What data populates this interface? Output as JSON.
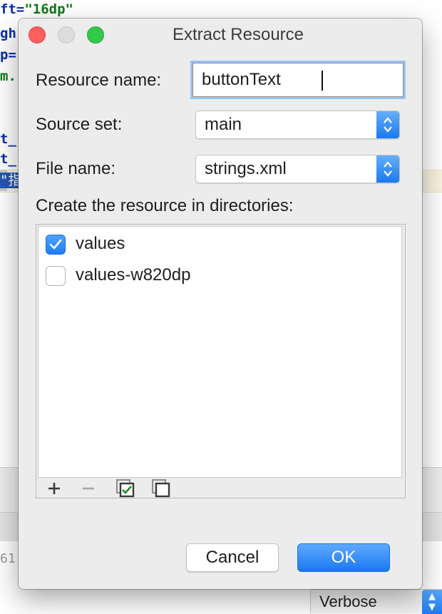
{
  "background": {
    "code_lines": [
      {
        "attr": "ft=",
        "value": "\"16dp\""
      },
      {
        "attr": "gh",
        "value": ""
      },
      {
        "attr": "p=",
        "value": ""
      },
      {
        "attr": "",
        "value": "m."
      },
      {
        "attr": "t_",
        "value": ""
      },
      {
        "attr": "t_",
        "value": ""
      }
    ],
    "highlighted_fragment": "\"指",
    "side_number": "61",
    "log_level_dropdown": "Verbose"
  },
  "dialog": {
    "title": "Extract Resource",
    "resource_name": {
      "label": "Resource name:",
      "value": "buttonText"
    },
    "source_set": {
      "label": "Source set:",
      "selected": "main"
    },
    "file_name": {
      "label": "File name:",
      "selected": "strings.xml"
    },
    "directories": {
      "label": "Create the resource in directories:",
      "items": [
        {
          "label": "values",
          "checked": true
        },
        {
          "label": "values-w820dp",
          "checked": false
        }
      ],
      "toolbar": [
        "add-icon",
        "remove-icon",
        "select-all-icon",
        "unselect-all-icon"
      ]
    },
    "buttons": {
      "cancel": "Cancel",
      "ok": "OK"
    }
  },
  "colors": {
    "accent": "#1a79ef",
    "close": "#fc605c",
    "zoom": "#34c84a",
    "checkmark": "#1a8a2a"
  }
}
